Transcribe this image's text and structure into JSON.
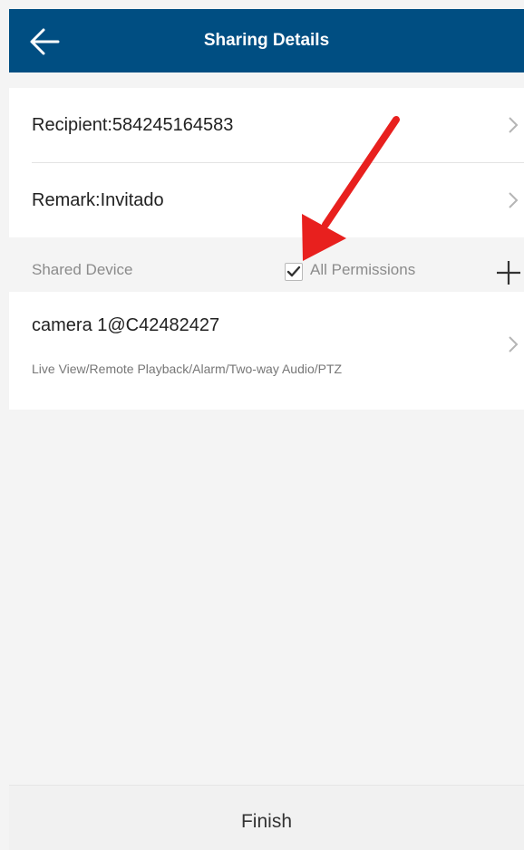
{
  "header": {
    "title": "Sharing Details"
  },
  "rows": {
    "recipient_label": "Recipient:584245164583",
    "remark_label": "Remark:Invitado"
  },
  "shared_section": {
    "title": "Shared Device",
    "all_permissions_label": "All Permissions",
    "all_permissions_checked": true
  },
  "device": {
    "name": "camera 1@C42482427",
    "permissions": "Live View/Remote Playback/Alarm/Two-way Audio/PTZ"
  },
  "footer": {
    "finish_label": "Finish"
  },
  "colors": {
    "header_bg": "#004e82",
    "annotation_arrow": "#e8201e"
  }
}
